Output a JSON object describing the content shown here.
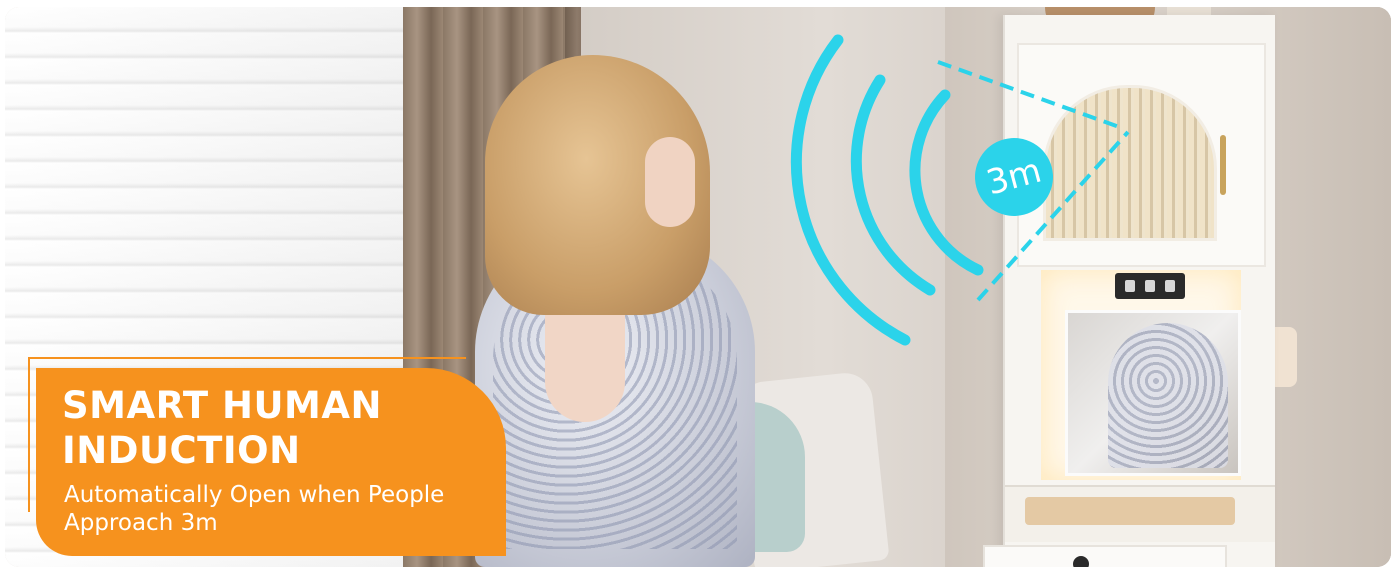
{
  "headline": {
    "line1": "SMART HUMAN",
    "line2": "INDUCTION"
  },
  "subtext": {
    "line1": "Automatically Open when People",
    "line2": "Approach 3m"
  },
  "sensor_badge": {
    "label": "3m"
  },
  "colors": {
    "accent_orange": "#f6921e",
    "sensor_cyan": "#2bd3ea",
    "text_white": "#ffffff"
  },
  "icons": [
    "sensor-wave-icon",
    "distance-badge-icon"
  ]
}
